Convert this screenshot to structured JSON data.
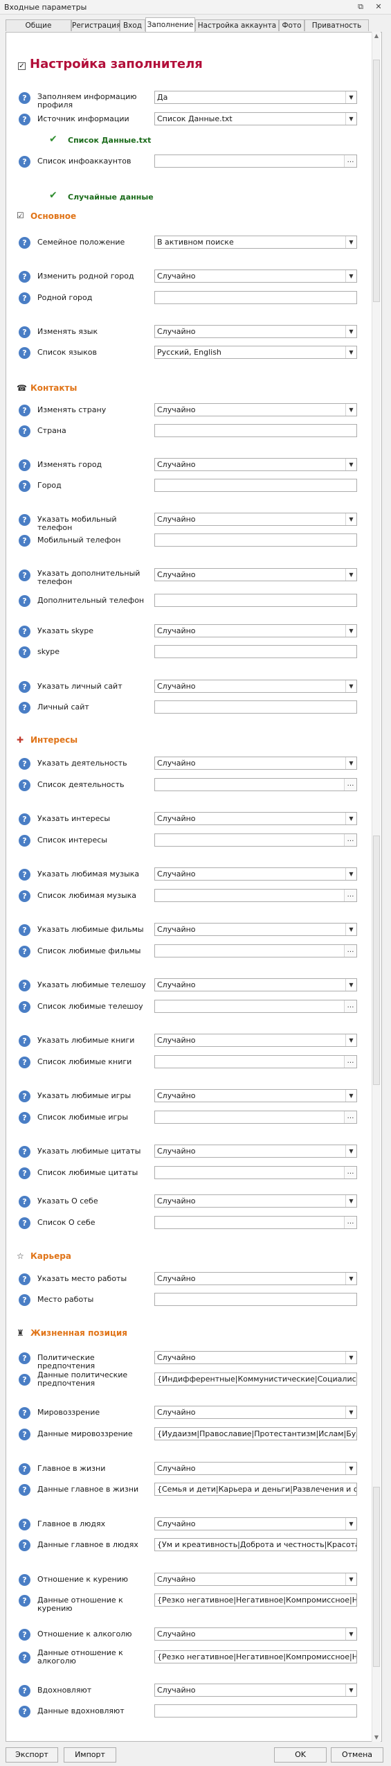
{
  "window": {
    "title": "Входные параметры",
    "restore": "⧉",
    "close": "✕"
  },
  "tabs": [
    "Общие настройки",
    "Регистрация",
    "Вход",
    "Заполнение",
    "Настройка аккаунта",
    "Фото",
    "Приватность"
  ],
  "active_tab": "Заполнение",
  "page_title": "Настройка заполнителя",
  "sections": {
    "s1": "Основное",
    "s2": "Контакты",
    "s3": "Интересы",
    "s4": "Карьера",
    "s5": "Жизненная позиция"
  },
  "checked": {
    "c1": "Список Данные.txt",
    "c2": "Случайные данные"
  },
  "rows": {
    "r1": {
      "label": "Заполняем информацию профиля",
      "value": "Да"
    },
    "r2": {
      "label": "Источник информации",
      "value": "Список Данные.txt"
    },
    "r3": {
      "label": "Список инфоаккаунтов",
      "value": ""
    },
    "r4": {
      "label": "Семейное положение",
      "value": "В активном поиске"
    },
    "r5": {
      "label": "Изменить родной город",
      "value": "Случайно"
    },
    "r6": {
      "label": "Родной город",
      "value": ""
    },
    "r7": {
      "label": "Изменять язык",
      "value": "Случайно"
    },
    "r8": {
      "label": "Список языков",
      "value": "Русский, English"
    },
    "r9": {
      "label": "Изменять страну",
      "value": "Случайно"
    },
    "r10": {
      "label": "Страна",
      "value": ""
    },
    "r11": {
      "label": "Изменять город",
      "value": "Случайно"
    },
    "r12": {
      "label": "Город",
      "value": ""
    },
    "r13": {
      "label": "Указать мобильный телефон",
      "value": "Случайно"
    },
    "r14": {
      "label": "Мобильный телефон",
      "value": ""
    },
    "r15": {
      "label": "Указать дополнительный телефон",
      "value": "Случайно"
    },
    "r16": {
      "label": "Дополнительный телефон",
      "value": ""
    },
    "r17": {
      "label": "Указать skype",
      "value": "Случайно"
    },
    "r18": {
      "label": "skype",
      "value": ""
    },
    "r19": {
      "label": "Указать личный сайт",
      "value": "Случайно"
    },
    "r20": {
      "label": "Личный сайт",
      "value": ""
    },
    "r21": {
      "label": "Указать деятельность",
      "value": "Случайно"
    },
    "r22": {
      "label": "Список деятельность",
      "value": ""
    },
    "r23": {
      "label": "Указать интересы",
      "value": "Случайно"
    },
    "r24": {
      "label": "Список интересы",
      "value": ""
    },
    "r25": {
      "label": "Указать любимая музыка",
      "value": "Случайно"
    },
    "r26": {
      "label": "Список  любимая музыка",
      "value": ""
    },
    "r27": {
      "label": "Указать любимые фильмы",
      "value": "Случайно"
    },
    "r28": {
      "label": "Список любимые фильмы",
      "value": ""
    },
    "r29": {
      "label": "Указать любимые телешоу",
      "value": "Случайно"
    },
    "r30": {
      "label": "Список любимые телешоу",
      "value": ""
    },
    "r31": {
      "label": "Указать любимые книги",
      "value": "Случайно"
    },
    "r32": {
      "label": "Список любимые книги",
      "value": ""
    },
    "r33": {
      "label": "Указать любимые игры",
      "value": "Случайно"
    },
    "r34": {
      "label": "Список любимые игры",
      "value": ""
    },
    "r35": {
      "label": "Указать любимые цитаты",
      "value": "Случайно"
    },
    "r36": {
      "label": "Список любимые цитаты",
      "value": ""
    },
    "r37": {
      "label": "Указать О себе",
      "value": "Случайно"
    },
    "r38": {
      "label": "Список О себе",
      "value": ""
    },
    "r39": {
      "label": "Указать место работы",
      "value": "Случайно"
    },
    "r40": {
      "label": "Место работы",
      "value": ""
    },
    "r41": {
      "label": "Политические предпочтения",
      "value": "Случайно"
    },
    "r42": {
      "label": "Данные политические предпочтения",
      "value": "{Индифферентные|Коммунистические|Социалистически"
    },
    "r43": {
      "label": "Мировоззрение",
      "value": "Случайно"
    },
    "r44": {
      "label": "Данные мировоззрение",
      "value": "{Иудаизм|Православие|Протестантизм|Ислам|Буддизм|К"
    },
    "r45": {
      "label": "Главное в жизни",
      "value": "Случайно"
    },
    "r46": {
      "label": "Данные главное в жизни",
      "value": "{Семья и дети|Карьера и деньги|Развлечения и отдых|"
    },
    "r47": {
      "label": "Главное в людях",
      "value": "Случайно"
    },
    "r48": {
      "label": "Данные главное в людях",
      "value": "{Ум и креативность|Доброта и честность|Красота и здо"
    },
    "r49": {
      "label": "Отношение к курению",
      "value": "Случайно"
    },
    "r50": {
      "label": "Данные отношение к курению",
      "value": "{Резко негативное|Негативное|Компромиссное|Нейтрал"
    },
    "r51": {
      "label": "Отношение к алкоголю",
      "value": "Случайно"
    },
    "r52": {
      "label": "Данные отношение к алкоголю",
      "value": "{Резко негативное|Негативное|Компромиссное|Нейтрал"
    },
    "r53": {
      "label": "Вдохновляют",
      "value": "Случайно"
    },
    "r54": {
      "label": "Данные вдохновляют",
      "value": ""
    }
  },
  "footer": {
    "export": "Экспорт",
    "import": "Импорт",
    "ok": "OK",
    "cancel": "Отмена"
  }
}
